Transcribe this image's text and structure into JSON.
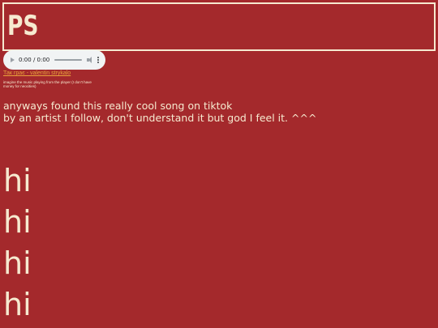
{
  "header": {
    "logo_text": "PS"
  },
  "audio": {
    "time": "0:00 / 0:00"
  },
  "song": {
    "link_text": "Так грає - valentin strykalo",
    "note": "imagine the music playing from the player (I don't have money for neocities)"
  },
  "paragraph": {
    "line1": "anyways found this really cool song on tiktok",
    "line2": "by an artist I follow, don't understand it but god I feel it. ^^^"
  },
  "greetings": [
    "hi",
    "hi",
    "hi",
    "hi"
  ],
  "colors": {
    "background": "#a4292c",
    "text": "#f6ead0",
    "link": "#e9a23b"
  }
}
